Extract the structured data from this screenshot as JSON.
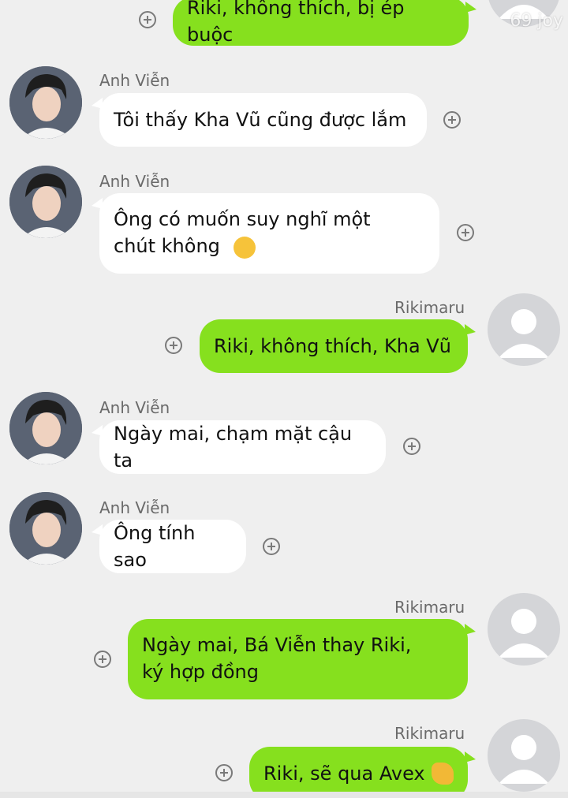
{
  "watermark": "69 joy",
  "messages": [
    {
      "side": "out",
      "sender": "",
      "text": "Riki, không thích, bị ép buộc",
      "emoji": ""
    },
    {
      "side": "in",
      "sender": "Anh Viễn",
      "text": "Tôi thấy Kha Vũ cũng được lắm",
      "emoji": ""
    },
    {
      "side": "in",
      "sender": "Anh Viễn",
      "text": "Ông có muốn suy nghĩ một\nchút không",
      "emoji": "shush-face-emoji"
    },
    {
      "side": "out",
      "sender": "Rikimaru",
      "text": "Riki, không thích, Kha Vũ",
      "emoji": ""
    },
    {
      "side": "in",
      "sender": "Anh Viễn",
      "text": "Ngày mai, chạm mặt cậu ta",
      "emoji": ""
    },
    {
      "side": "in",
      "sender": "Anh Viễn",
      "text": "Ông tính sao",
      "emoji": ""
    },
    {
      "side": "out",
      "sender": "Rikimaru",
      "text": "Ngày mai, Bá Viễn thay Riki,\nký hợp đồng",
      "emoji": ""
    },
    {
      "side": "out",
      "sender": "Rikimaru",
      "text": "Riki, sẽ qua Avex",
      "emoji": "ok-hand-emoji"
    }
  ],
  "colors": {
    "background": "#efefef",
    "incoming_bubble": "#ffffff",
    "outgoing_bubble": "#86e01e",
    "sender_name": "#6a6a6a"
  }
}
